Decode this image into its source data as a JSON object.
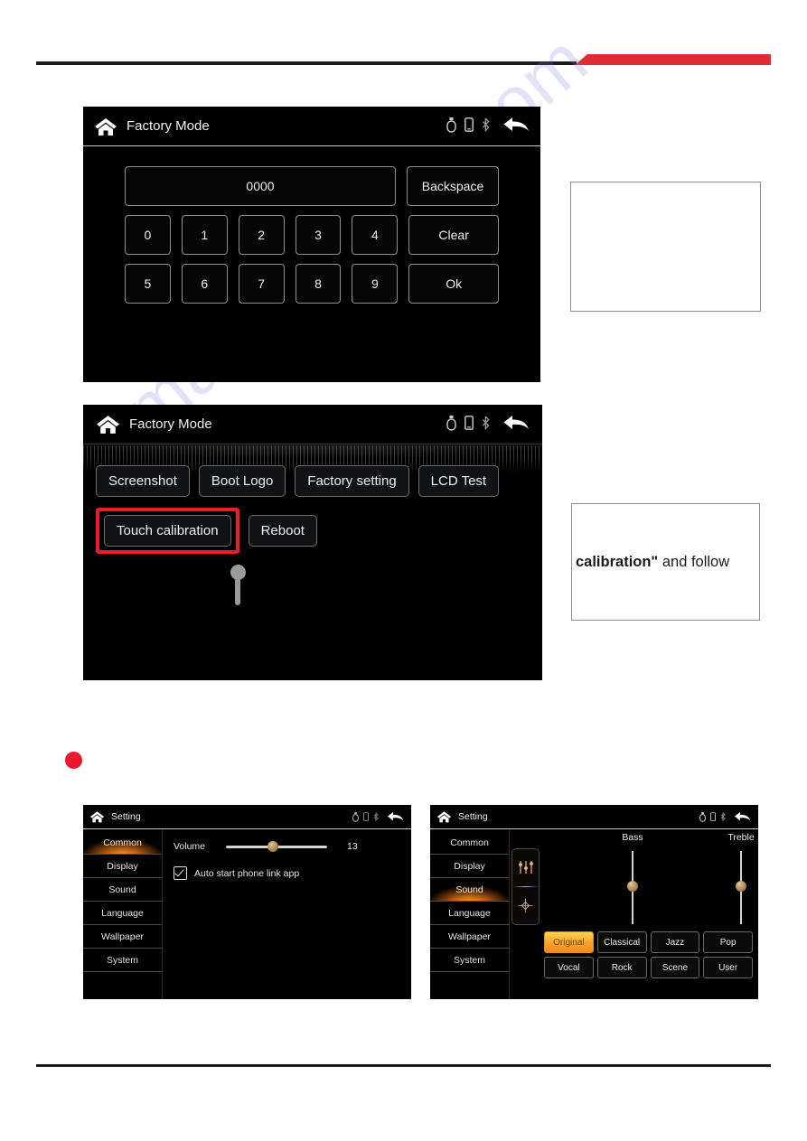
{
  "watermark": {
    "text": "manualshive.com"
  },
  "keypad_screen": {
    "title": "Factory Mode",
    "display_value": "0000",
    "backspace_label": "Backspace",
    "keys_row1": [
      "0",
      "1",
      "2",
      "3",
      "4"
    ],
    "clear_label": "Clear",
    "keys_row2": [
      "5",
      "6",
      "7",
      "8",
      "9"
    ],
    "ok_label": "Ok"
  },
  "factory_screen": {
    "title": "Factory Mode",
    "buttons_row1": [
      "Screenshot",
      "Boot Logo",
      "Factory setting",
      "LCD Test"
    ],
    "highlighted_button": "Touch calibration",
    "reboot_label": "Reboot"
  },
  "callouts": {
    "top": {
      "text": ""
    },
    "bottom": {
      "bold_text": "calibration\"",
      "rest_text": " and follow"
    }
  },
  "common_screen": {
    "title": "Setting",
    "nav_items": [
      "Common",
      "Display",
      "Sound",
      "Language",
      "Wallpaper",
      "System"
    ],
    "active_nav": "Common",
    "volume_label": "Volume",
    "volume_value": "13",
    "auto_start_label": "Auto start phone link app"
  },
  "sound_screen": {
    "title": "Setting",
    "nav_items": [
      "Common",
      "Display",
      "Sound",
      "Language",
      "Wallpaper",
      "System"
    ],
    "active_nav": "Sound",
    "bass_label": "Bass",
    "treble_label": "Treble",
    "presets": [
      "Original",
      "Classical",
      "Jazz",
      "Pop",
      "Vocal",
      "Rock",
      "Scene",
      "User"
    ],
    "active_preset": "Original"
  },
  "colors": {
    "accent_red": "#e02b38",
    "highlight_red": "#ee1c25",
    "bullet_red": "#e8192c",
    "preset_active": "#f9a22b",
    "nav_active": "#d4761d"
  }
}
